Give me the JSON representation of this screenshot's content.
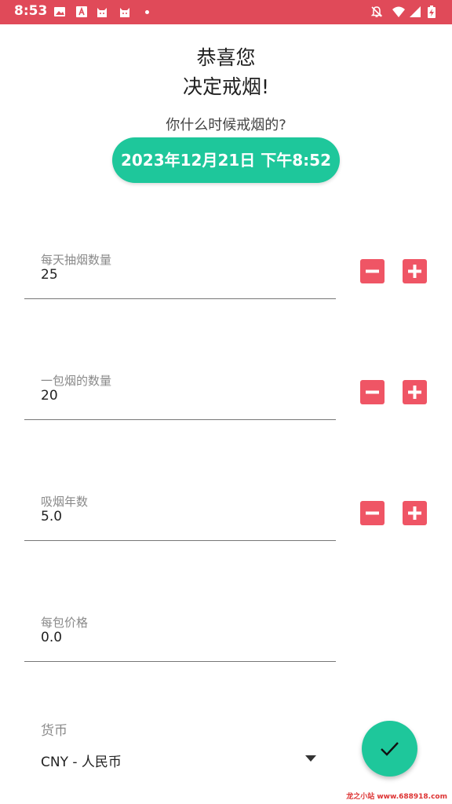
{
  "status_bar": {
    "time": "8:53"
  },
  "header": {
    "line1": "恭喜您",
    "line2": "决定戒烟!"
  },
  "question": "你什么时候戒烟的?",
  "date_button": "2023年12月21日 下午8:52",
  "fields": [
    {
      "label": "每天抽烟数量",
      "value": "25"
    },
    {
      "label": "一包烟的数量",
      "value": "20"
    },
    {
      "label": "吸烟年数",
      "value": "5.0"
    },
    {
      "label": "每包价格",
      "value": "0.0"
    }
  ],
  "currency": {
    "label": "货币",
    "value": "CNY - 人民币"
  },
  "watermark": "龙之小站 www.688918.com",
  "colors": {
    "status_bar": "#e04a59",
    "accent": "#1ec79b",
    "stepper": "#ef5565"
  },
  "icons": [
    "image-icon",
    "a-icon",
    "cat-icon",
    "cat-icon",
    "notifications-off-icon",
    "wifi-icon",
    "signal-icon",
    "battery-charging-icon",
    "minus-icon",
    "plus-icon",
    "dropdown-arrow-icon",
    "check-icon"
  ]
}
